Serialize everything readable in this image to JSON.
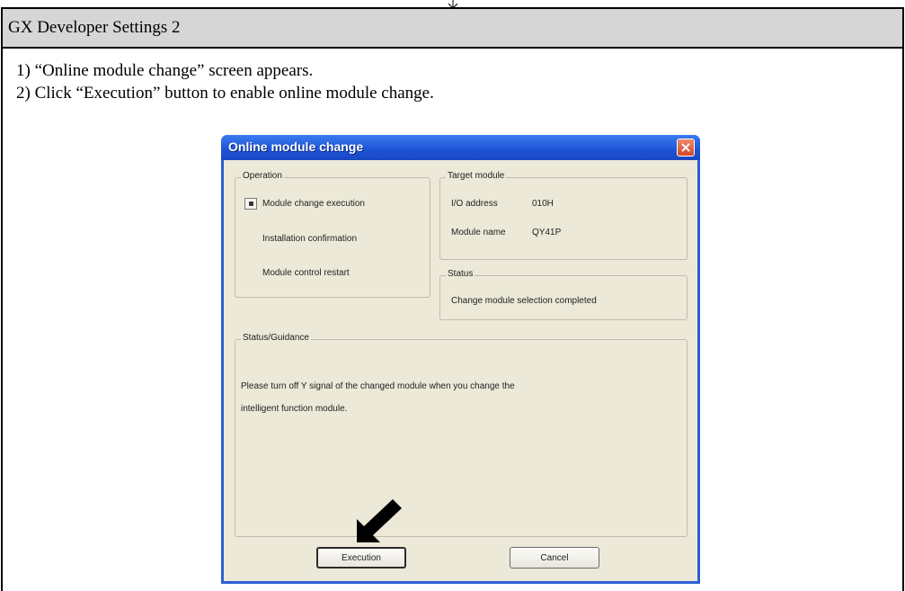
{
  "section": {
    "title": "GX Developer Settings 2"
  },
  "steps": [
    "1) “Online module change” screen appears.",
    "2) Click “Execution” button to enable online module change."
  ],
  "dialog": {
    "title": "Online module change",
    "operation": {
      "label": "Operation",
      "items": [
        "Module change execution",
        "Installation confirmation",
        "Module control restart"
      ]
    },
    "target_module": {
      "label": "Target module",
      "io_address_label": "I/O address",
      "io_address_value": "010H",
      "module_name_label": "Module name",
      "module_name_value": "QY41P"
    },
    "status": {
      "label": "Status",
      "value": "Change module selection completed"
    },
    "guidance": {
      "label": "Status/Guidance",
      "line1": "Please turn off Y signal of the changed module when you change the",
      "line2": "intelligent function module."
    },
    "buttons": {
      "execute": "Execution",
      "cancel": "Cancel"
    }
  },
  "colors": {
    "titlebar": "#1d52d4",
    "dialog_body": "#ece9d8",
    "close": "#d4472a",
    "header": "#d6d6d6"
  }
}
